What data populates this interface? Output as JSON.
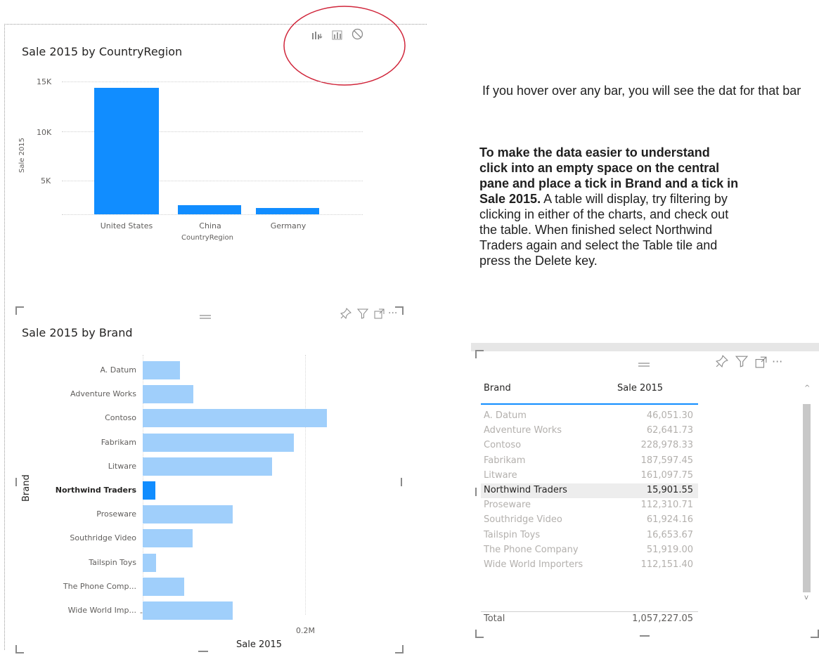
{
  "chart1": {
    "title": "Sale 2015 by CountryRegion",
    "chart_data": {
      "type": "bar",
      "title": "Sale 2015 by CountryRegion",
      "xlabel": "CountryRegion",
      "ylabel": "Sale 2015",
      "categories": [
        "United States",
        "China",
        "Germany"
      ],
      "values": [
        14300,
        1000,
        700
      ],
      "ylim": [
        0,
        15000
      ],
      "yticks": [
        "15K",
        "10K",
        "5K"
      ],
      "color": "#118dff",
      "grid": true
    },
    "header_icons": [
      "drill-down-icon",
      "drill-mode-icon",
      "clear-filter-icon"
    ]
  },
  "chart2": {
    "title": "Sale 2015 by Brand",
    "header_icons": [
      "pin-icon",
      "filter-icon",
      "focus-mode-icon",
      "more-options-icon"
    ],
    "chart_data": {
      "type": "bar",
      "orientation": "horizontal",
      "title": "Sale 2015 by Brand",
      "xlabel": "Sale 2015",
      "ylabel": "Brand",
      "categories": [
        "A. Datum",
        "Adventure Works",
        "Contoso",
        "Fabrikam",
        "Litware",
        "Northwind Traders",
        "Proseware",
        "Southridge Video",
        "Tailspin Toys",
        "The Phone Comp...",
        "Wide World Imp..."
      ],
      "values": [
        46051.3,
        62641.73,
        228978.33,
        187597.45,
        161097.75,
        15901.55,
        112310.71,
        61924.16,
        16653.67,
        51919.0,
        112151.4
      ],
      "highlighted": "Northwind Traders",
      "xlim": [
        0,
        230000
      ],
      "xticks": [
        "0.2M"
      ],
      "highlight_color": "#118dff",
      "dim_color": "#a0cffb",
      "grid": true
    }
  },
  "instructions": {
    "p1": "If you hover over any bar, you will see the dat for that bar",
    "p2_line1": "To make the data easier to understand",
    "p2_line2": "click into an empty space on the central",
    "p2_line3": "pane and place a tick in Brand and a tick in",
    "p2_line4_bold": "Sale 2015.",
    "p2_line4_rest": "  A table will display, try filtering by",
    "p2_line5": "clicking in either of the charts, and check out",
    "p2_line6": "the table. When finished  select Northwind",
    "p2_line7": "Traders again and select the Table tile and",
    "p2_line8": "press the Delete key."
  },
  "table": {
    "header_icons": [
      "pin-icon",
      "filter-icon",
      "focus-mode-icon",
      "more-options-icon"
    ],
    "columns": [
      "Brand",
      "Sale 2015"
    ],
    "rows": [
      {
        "brand": "A. Datum",
        "value": "46,051.30",
        "selected": false
      },
      {
        "brand": "Adventure Works",
        "value": "62,641.73",
        "selected": false
      },
      {
        "brand": "Contoso",
        "value": "228,978.33",
        "selected": false
      },
      {
        "brand": "Fabrikam",
        "value": "187,597.45",
        "selected": false
      },
      {
        "brand": "Litware",
        "value": "161,097.75",
        "selected": false
      },
      {
        "brand": "Northwind Traders",
        "value": "15,901.55",
        "selected": true
      },
      {
        "brand": "Proseware",
        "value": "112,310.71",
        "selected": false
      },
      {
        "brand": "Southridge Video",
        "value": "61,924.16",
        "selected": false
      },
      {
        "brand": "Tailspin Toys",
        "value": "16,653.67",
        "selected": false
      },
      {
        "brand": "The Phone Company",
        "value": "51,919.00",
        "selected": false
      },
      {
        "brand": "Wide World Importers",
        "value": "112,151.40",
        "selected": false
      }
    ],
    "total_label": "Total",
    "total_value": "1,057,227.05",
    "colors": {
      "accent": "#118dff",
      "dim_text": "#b3b0ad",
      "selected_bg": "#ededed"
    }
  },
  "annotation": {
    "circle_color": "#d0253a"
  }
}
